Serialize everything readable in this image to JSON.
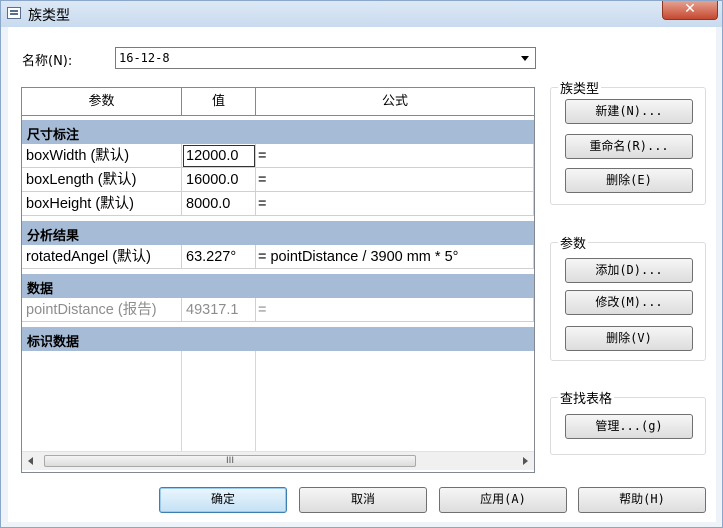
{
  "window": {
    "title": "族类型",
    "close_glyph": "✕"
  },
  "name_field": {
    "label": "名称(N):",
    "value": "16-12-8"
  },
  "table": {
    "headers": [
      "参数",
      "值",
      "公式"
    ],
    "sections": [
      {
        "name": "尺寸标注",
        "rows": [
          {
            "param": "boxWidth (默认)",
            "value": "12000.0",
            "formula": "="
          },
          {
            "param": "boxLength (默认)",
            "value": "16000.0",
            "formula": "="
          },
          {
            "param": "boxHeight (默认)",
            "value": "8000.0",
            "formula": "="
          }
        ]
      },
      {
        "name": "分析结果",
        "rows": [
          {
            "param": "rotatedAngel (默认)",
            "value": "63.227°",
            "formula": "= pointDistance / 3900 mm * 5°"
          }
        ]
      },
      {
        "name": "数据",
        "rows": [
          {
            "param": "pointDistance (报告)",
            "value": "49317.1",
            "formula": "="
          }
        ]
      },
      {
        "name": "标识数据",
        "rows": []
      }
    ],
    "scroll_thumb_glyph": "III"
  },
  "family_types_group": {
    "label": "族类型",
    "new_button": "新建(N)...",
    "rename_button": "重命名(R)...",
    "delete_button": "删除(E)"
  },
  "parameters_group": {
    "label": "参数",
    "add_button": "添加(D)...",
    "modify_button": "修改(M)...",
    "delete_button": "删除(V)"
  },
  "lookup_group": {
    "label": "查找表格",
    "manage_button": "管理...(g)"
  },
  "footer": {
    "ok_button": "确定",
    "cancel_button": "取消",
    "apply_button": "应用(A)",
    "help_button": "帮助(H)"
  }
}
